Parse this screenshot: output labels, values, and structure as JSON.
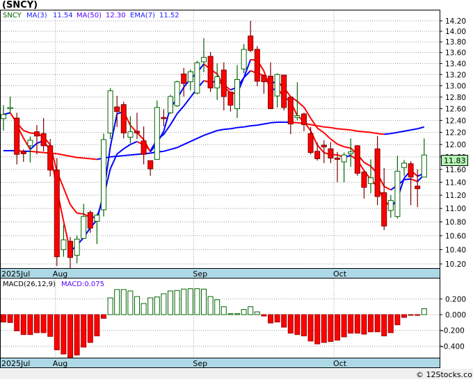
{
  "header": {
    "title": "(SNCY)",
    "legend": {
      "symbol": "SNCY",
      "ma3_label": "MA(3)",
      "ma3_value": "11.54",
      "ma50_label": "MA(50)",
      "ma50_value": "12.30",
      "ema7_label": "EMA(7)",
      "ema7_value": "11.52"
    }
  },
  "macd_legend": {
    "params": "MACD(26,12,9)",
    "value": "MACD:0.075"
  },
  "last_price_badge": "11.83",
  "footer": "© 12Stocks.com",
  "colors": {
    "up": "#006400",
    "down": "#ff0000",
    "ma_rising": "#0000ff",
    "ma_falling": "#ff0000",
    "axis_band": "#add8e6",
    "price_badge": "#b3f5b3"
  },
  "chart_data": [
    {
      "type": "candlestick",
      "y_scale": "log",
      "ylim": [
        10.2,
        14.2
      ],
      "grid": true,
      "yticks": [
        "14.20",
        "14.00",
        "13.80",
        "13.60",
        "13.40",
        "13.20",
        "13.00",
        "12.80",
        "12.60",
        "12.40",
        "12.20",
        "12.00",
        "11.80",
        "11.60",
        "11.40",
        "11.20",
        "11.00",
        "10.80",
        "10.60",
        "10.40",
        "10.20"
      ],
      "xtick_labels": [
        {
          "label": "2025Jul",
          "index": 0
        },
        {
          "label": "Aug",
          "index": 8
        },
        {
          "label": "Sep",
          "index": 29
        },
        {
          "label": "Oct",
          "index": 50
        }
      ],
      "ohlc": [
        [
          12.43,
          12.66,
          12.23,
          12.5
        ],
        [
          12.6,
          12.81,
          12.52,
          12.62
        ],
        [
          12.44,
          12.53,
          11.68,
          11.84
        ],
        [
          11.88,
          11.92,
          11.72,
          11.85
        ],
        [
          11.98,
          12.13,
          11.71,
          12.07
        ],
        [
          12.21,
          12.32,
          11.84,
          12.14
        ],
        [
          12.18,
          12.44,
          11.89,
          11.98
        ],
        [
          11.98,
          12.09,
          11.49,
          11.59
        ],
        [
          11.59,
          11.78,
          10.17,
          10.3
        ],
        [
          10.4,
          10.76,
          10.3,
          10.54
        ],
        [
          10.52,
          10.58,
          10.12,
          10.29
        ],
        [
          10.32,
          10.6,
          10.21,
          10.55
        ],
        [
          10.56,
          11.07,
          10.55,
          10.88
        ],
        [
          10.94,
          10.97,
          10.64,
          10.71
        ],
        [
          10.81,
          10.92,
          10.48,
          10.9
        ],
        [
          10.98,
          12.18,
          10.88,
          12.08
        ],
        [
          12.19,
          12.96,
          12.09,
          12.91
        ],
        [
          12.63,
          12.82,
          12.29,
          12.55
        ],
        [
          12.67,
          12.72,
          12.1,
          12.19
        ],
        [
          12.12,
          12.47,
          12.02,
          12.21
        ],
        [
          12.22,
          12.53,
          12.09,
          12.19
        ],
        [
          12.06,
          12.3,
          11.68,
          11.84
        ],
        [
          11.74,
          11.74,
          11.5,
          11.61
        ],
        [
          11.76,
          12.74,
          11.76,
          12.62
        ],
        [
          12.45,
          12.59,
          12.3,
          12.43
        ],
        [
          12.53,
          12.84,
          12.51,
          12.81
        ],
        [
          12.65,
          13.09,
          12.63,
          13.07
        ],
        [
          13.21,
          13.32,
          12.81,
          13.04
        ],
        [
          13.07,
          13.29,
          12.92,
          13.25
        ],
        [
          12.87,
          13.45,
          12.85,
          13.41
        ],
        [
          13.43,
          13.87,
          13.24,
          13.51
        ],
        [
          13.53,
          13.61,
          12.89,
          12.96
        ],
        [
          12.96,
          13.4,
          12.75,
          13.16
        ],
        [
          13.28,
          13.42,
          12.57,
          12.81
        ],
        [
          12.89,
          12.89,
          12.55,
          12.66
        ],
        [
          12.6,
          13.37,
          12.44,
          13.11
        ],
        [
          13.3,
          13.76,
          13.22,
          13.66
        ],
        [
          13.91,
          14.2,
          13.61,
          13.64
        ],
        [
          13.66,
          13.72,
          12.99,
          13.08
        ],
        [
          13.18,
          13.18,
          12.86,
          13.07
        ],
        [
          13.17,
          13.42,
          12.59,
          12.6
        ],
        [
          12.82,
          13.22,
          12.62,
          13.2
        ],
        [
          13.19,
          13.19,
          12.57,
          12.62
        ],
        [
          12.8,
          12.8,
          12.17,
          12.34
        ],
        [
          12.45,
          13.06,
          12.4,
          12.48
        ],
        [
          12.51,
          12.53,
          12.22,
          12.33
        ],
        [
          12.18,
          12.29,
          11.84,
          11.87
        ],
        [
          11.89,
          12.03,
          11.74,
          11.77
        ],
        [
          11.99,
          12.07,
          11.7,
          11.96
        ],
        [
          11.93,
          12.04,
          11.7,
          11.78
        ],
        [
          11.78,
          11.88,
          11.4,
          11.76
        ],
        [
          11.72,
          11.87,
          11.4,
          11.83
        ],
        [
          11.85,
          12.1,
          11.64,
          11.88
        ],
        [
          11.98,
          11.99,
          11.5,
          11.54
        ],
        [
          11.56,
          11.58,
          11.15,
          11.32
        ],
        [
          11.38,
          11.76,
          11.23,
          11.47
        ],
        [
          11.93,
          12.14,
          11.05,
          11.18
        ],
        [
          11.24,
          11.62,
          10.68,
          10.74
        ],
        [
          10.97,
          11.2,
          10.86,
          11.12
        ],
        [
          10.88,
          11.82,
          10.85,
          11.57
        ],
        [
          11.63,
          11.75,
          11.5,
          11.7
        ],
        [
          11.69,
          11.73,
          11.05,
          11.48
        ],
        [
          11.34,
          11.6,
          11.02,
          11.3
        ],
        [
          11.48,
          12.1,
          11.48,
          11.83
        ]
      ],
      "ma50": [
        11.9,
        11.9,
        11.9,
        11.89,
        11.89,
        11.88,
        11.87,
        11.86,
        11.85,
        11.83,
        11.81,
        11.79,
        11.78,
        11.77,
        11.76,
        11.78,
        11.8,
        11.81,
        11.82,
        11.83,
        11.84,
        11.85,
        11.86,
        11.88,
        11.89,
        11.92,
        11.95,
        12.0,
        12.05,
        12.1,
        12.15,
        12.19,
        12.23,
        12.25,
        12.26,
        12.28,
        12.29,
        12.31,
        12.32,
        12.34,
        12.36,
        12.37,
        12.37,
        12.37,
        12.36,
        12.35,
        12.33,
        12.31,
        12.29,
        12.28,
        12.26,
        12.25,
        12.24,
        12.22,
        12.21,
        12.2,
        12.18,
        12.17,
        12.18,
        12.2,
        12.22,
        12.24,
        12.26,
        12.29
      ]
    },
    {
      "type": "bar",
      "name": "MACD histogram",
      "ylim": [
        -0.6,
        0.4
      ],
      "yticks": [
        "0.200",
        "0.000",
        "-0.200",
        "-0.400"
      ],
      "values": [
        -0.094,
        -0.1,
        -0.206,
        -0.253,
        -0.253,
        -0.229,
        -0.229,
        -0.276,
        -0.447,
        -0.5,
        -0.547,
        -0.512,
        -0.412,
        -0.353,
        -0.27,
        -0.047,
        0.212,
        0.318,
        0.318,
        0.3,
        0.229,
        0.141,
        0.212,
        0.224,
        0.265,
        0.3,
        0.306,
        0.324,
        0.329,
        0.329,
        0.324,
        0.229,
        0.188,
        0.1,
        0.012,
        0.012,
        0.065,
        0.1,
        0.035,
        -0.018,
        -0.106,
        -0.094,
        -0.159,
        -0.235,
        -0.253,
        -0.27,
        -0.335,
        -0.371,
        -0.353,
        -0.341,
        -0.324,
        -0.282,
        -0.235,
        -0.235,
        -0.247,
        -0.218,
        -0.218,
        -0.27,
        -0.229,
        -0.129,
        -0.035,
        -0.006,
        -0.003,
        0.075
      ]
    }
  ]
}
